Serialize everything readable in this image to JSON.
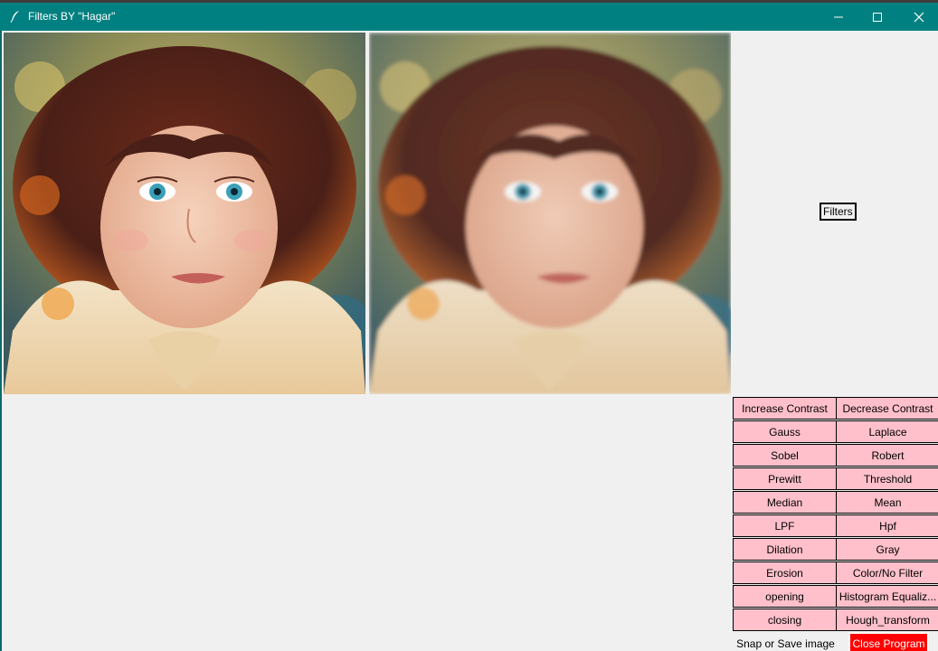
{
  "window": {
    "title": "Filters BY \"Hagar\"",
    "titlebar_color": "#008080",
    "controls": [
      "minimize-icon",
      "maximize-icon",
      "close-icon"
    ]
  },
  "images": [
    {
      "name": "original-image",
      "subject": "child portrait"
    },
    {
      "name": "filtered-image",
      "subject": "child portrait (filtered)"
    }
  ],
  "filters_label": "Filters",
  "buttons": [
    [
      "Increase Contrast",
      "Decrease Contrast"
    ],
    [
      "Gauss",
      "Laplace"
    ],
    [
      "Sobel",
      "Robert"
    ],
    [
      "Prewitt",
      "Threshold"
    ],
    [
      "Median",
      "Mean"
    ],
    [
      "LPF",
      "Hpf"
    ],
    [
      "Dilation",
      "Gray"
    ],
    [
      "Erosion",
      "Color/No Filter"
    ],
    [
      "opening",
      "Histogram Equaliz..."
    ],
    [
      "closing",
      "Hough_transform"
    ]
  ],
  "snap_button": "Snap or Save image",
  "close_button": "Close Program",
  "colors": {
    "button_bg": "#ffc0cb",
    "close_bg": "#ff0000",
    "window_bg": "#f0f0f0"
  }
}
